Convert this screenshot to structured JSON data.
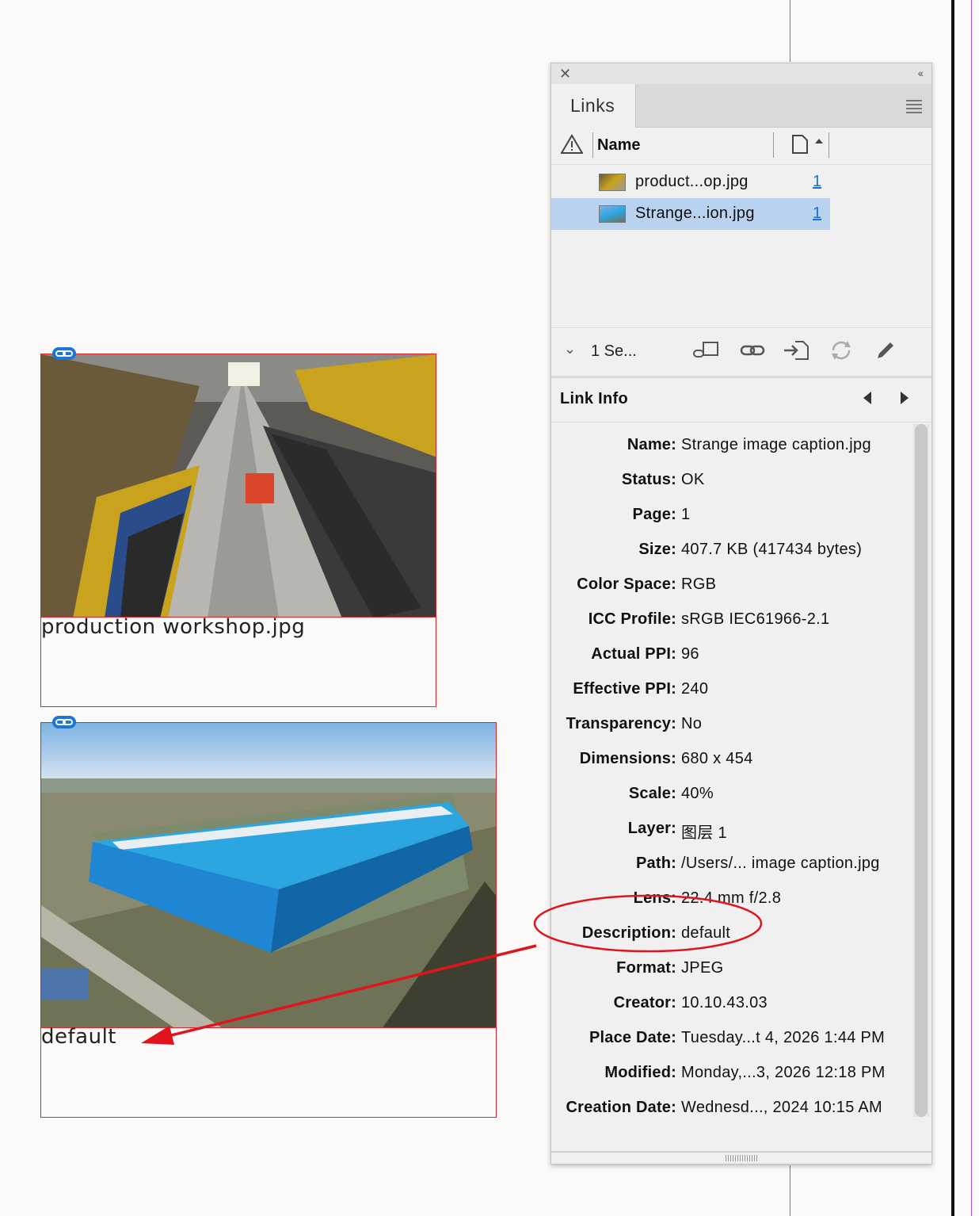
{
  "document": {
    "frames": [
      {
        "caption": "production workshop.jpg",
        "image": "production-workshop-photo"
      },
      {
        "caption": "default",
        "image": "factory-aerial-photo"
      }
    ]
  },
  "panel": {
    "tab_label": "Links",
    "column_name": "Name",
    "links": [
      {
        "name": "product...op.jpg",
        "page": "1",
        "selected": false
      },
      {
        "name": "Strange...ion.jpg",
        "page": "1",
        "selected": true
      }
    ],
    "selection_summary": "1 Se...",
    "toolbar_icons": [
      "relink-from-cc-icon",
      "relink-icon",
      "goto-link-icon",
      "update-link-icon",
      "edit-original-icon"
    ],
    "link_info_title": "Link Info",
    "link_info": [
      {
        "label": "Name:",
        "value": "Strange image caption.jpg"
      },
      {
        "label": "Status:",
        "value": "OK"
      },
      {
        "label": "Page:",
        "value": "1"
      },
      {
        "label": "Size:",
        "value": "407.7 KB (417434 bytes)"
      },
      {
        "label": "Color Space:",
        "value": "RGB"
      },
      {
        "label": "ICC Profile:",
        "value": "sRGB IEC61966-2.1"
      },
      {
        "label": "Actual PPI:",
        "value": "96"
      },
      {
        "label": "Effective PPI:",
        "value": "240"
      },
      {
        "label": "Transparency:",
        "value": "No"
      },
      {
        "label": "Dimensions:",
        "value": "680 x 454"
      },
      {
        "label": "Scale:",
        "value": "40%"
      },
      {
        "label": "Layer:",
        "value": "图层 1"
      },
      {
        "label": "Path:",
        "value": "/Users/... image caption.jpg"
      },
      {
        "label": "Lens:",
        "value": "22.4 mm f/2.8"
      },
      {
        "label": "Description:",
        "value": "default"
      },
      {
        "label": "Format:",
        "value": "JPEG"
      },
      {
        "label": "Creator:",
        "value": "10.10.43.03"
      },
      {
        "label": "Place Date:",
        "value": "Tuesday...t 4, 2026 1:44 PM"
      },
      {
        "label": "Modified:",
        "value": "Monday,...3, 2026 12:18 PM"
      },
      {
        "label": "Creation Date:",
        "value": "Wednesd..., 2024 10:15 AM"
      }
    ]
  },
  "annotation": {
    "color": "#e0141c"
  },
  "colors": {
    "frame_border": "#e0252a",
    "selection": "#b9d2ef",
    "guide": "#a64fd6",
    "link_page": "#1a6fd0"
  }
}
